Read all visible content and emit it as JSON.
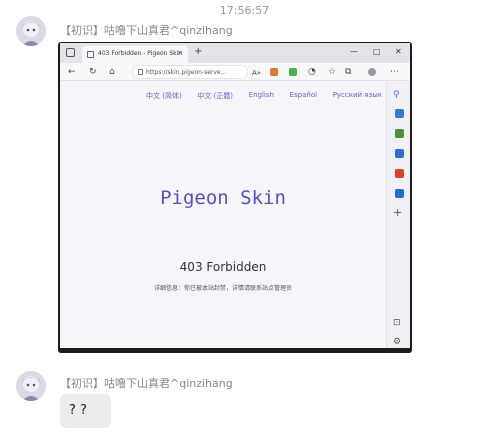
{
  "chat": {
    "timestamp": "17:56:57",
    "messages": [
      {
        "sender": "【初识】咕噜下山真君^qinzihang"
      },
      {
        "sender": "【初识】咕噜下山真君^qinzihang",
        "text": "? ?"
      }
    ]
  },
  "browser": {
    "tab_title": "403 Forbidden - Pigeon Skin",
    "tab_close": "×",
    "new_tab": "+",
    "window_controls": {
      "minimize": "—",
      "maximize": "□",
      "close": "✕"
    },
    "address": "https://skin.pigeon-serve...",
    "read_aloud": "A»",
    "page": {
      "languages": [
        "中文 (简体)",
        "中文 (正體)",
        "English",
        "Español",
        "Русский язык"
      ],
      "logo_text": "Pigeon Skin",
      "error_title": "403 Forbidden",
      "error_detail": "详细信息：你已被本站封禁，详情请联系站点管理员"
    }
  },
  "colors": {
    "accent": "#5750c4",
    "link": "#6b63c6",
    "bubble": "#ececec"
  },
  "icons": [
    "back-icon",
    "refresh-icon",
    "home-icon",
    "lock-icon",
    "favorites-icon",
    "collections-icon",
    "browser-essentials-icon",
    "profile-icon",
    "more-icon",
    "search-icon",
    "tag-icon",
    "briefcase-icon",
    "games-icon",
    "office-icon",
    "outlook-icon",
    "add-icon",
    "hide-sidebar-icon",
    "settings-icon"
  ]
}
